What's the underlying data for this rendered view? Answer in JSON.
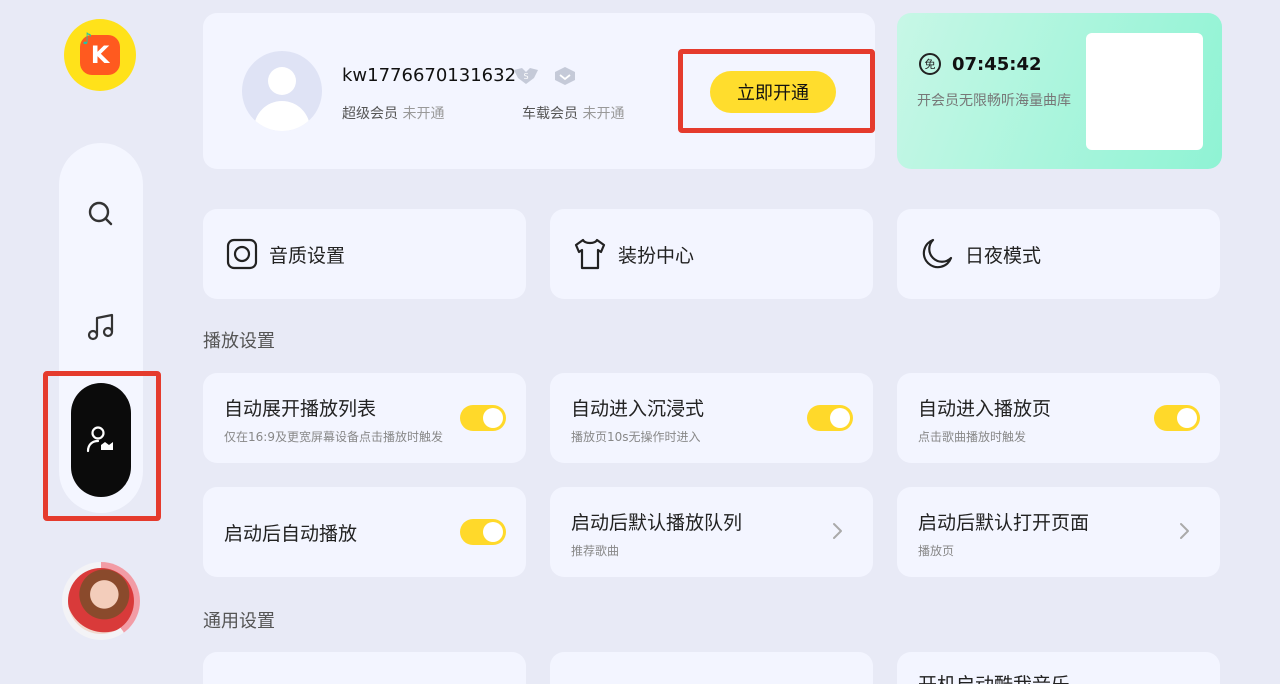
{
  "sidebar": {
    "logo_letter": "K",
    "items": [
      {
        "name": "search",
        "icon": "search-icon"
      },
      {
        "name": "music",
        "icon": "music-note-icon"
      },
      {
        "name": "profile",
        "icon": "user-vip-icon",
        "active": true
      }
    ]
  },
  "user": {
    "username": "kw1776670131632",
    "super_member_label": "超级会员",
    "super_member_status": "未开通",
    "car_member_label": "车载会员",
    "car_member_status": "未开通",
    "open_button": "立即开通"
  },
  "promo": {
    "icon_text": "免",
    "countdown": "07:45:42",
    "description": "开会员无限畅听海量曲库"
  },
  "quick_actions": [
    {
      "label": "音质设置",
      "icon": "speaker-icon"
    },
    {
      "label": "装扮中心",
      "icon": "tshirt-icon"
    },
    {
      "label": "日夜模式",
      "icon": "moon-icon"
    }
  ],
  "sections": {
    "playback_title": "播放设置",
    "general_title": "通用设置"
  },
  "playback_settings": [
    {
      "title": "自动展开播放列表",
      "subtitle": "仅在16:9及更宽屏幕设备点击播放时触发",
      "control": "toggle",
      "on": true
    },
    {
      "title": "自动进入沉浸式",
      "subtitle": "播放页10s无操作时进入",
      "control": "toggle",
      "on": true
    },
    {
      "title": "自动进入播放页",
      "subtitle": "点击歌曲播放时触发",
      "control": "toggle",
      "on": true
    },
    {
      "title": "启动后自动播放",
      "subtitle": "",
      "control": "toggle",
      "on": true
    },
    {
      "title": "启动后默认播放队列",
      "subtitle": "推荐歌曲",
      "control": "chevron"
    },
    {
      "title": "启动后默认打开页面",
      "subtitle": "播放页",
      "control": "chevron"
    }
  ],
  "general_settings": [
    {
      "title": ""
    },
    {
      "title": ""
    },
    {
      "title": "开机启动酷我音乐"
    }
  ],
  "colors": {
    "background": "#e8eaf6",
    "card": "#f3f5ff",
    "accent_yellow": "#ffdd2d",
    "highlight_red": "#e53b2d",
    "promo_green": "#8ff3d4"
  }
}
